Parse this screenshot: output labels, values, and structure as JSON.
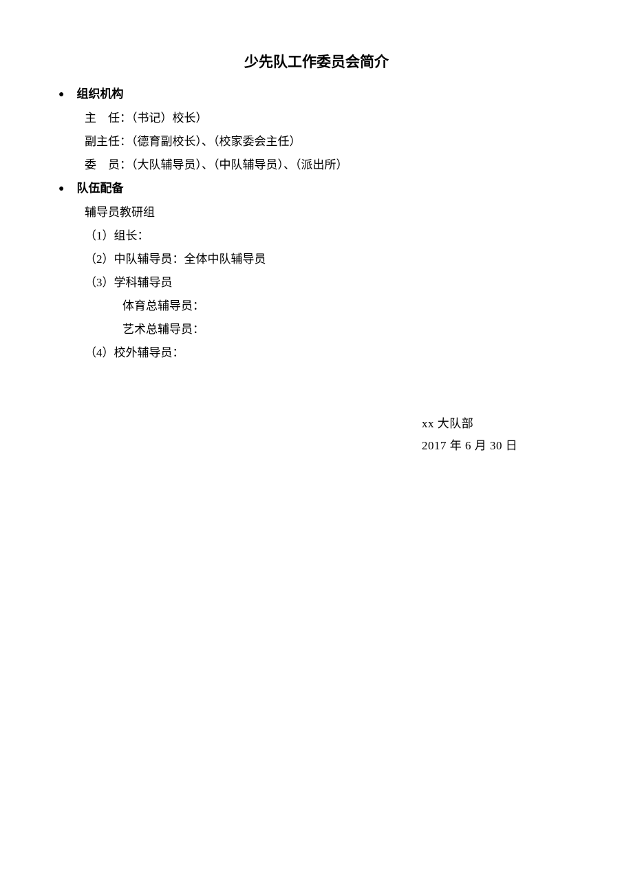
{
  "title": "少先队工作委员会简介",
  "section1": {
    "header": "组织机构",
    "lines": {
      "l1": "主　任：（书记）校长）",
      "l2": "副主任：（德育副校长）、（校家委会主任）",
      "l3": "委　员：（大队辅导员）、（中队辅导员）、（派出所）"
    }
  },
  "section2": {
    "header": "队伍配备",
    "lines": {
      "l1": "辅导员教研组",
      "l2": "（1）组长：",
      "l3": "（2）中队辅导员：全体中队辅导员",
      "l4": "（3）学科辅导员",
      "l5": "体育总辅导员：",
      "l6": "艺术总辅导员：",
      "l7": "（4）校外辅导员："
    }
  },
  "signature": {
    "org": "xx 大队部",
    "date": "2017 年 6 月 30 日"
  }
}
